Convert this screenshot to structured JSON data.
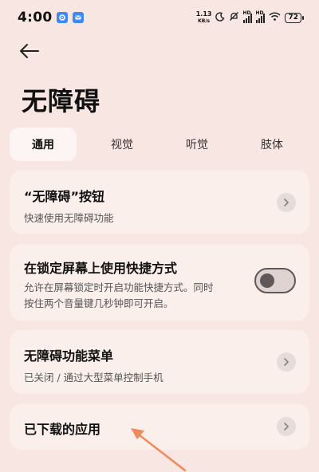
{
  "status_bar": {
    "time": "4:00",
    "net_speed_value": "1.13",
    "net_speed_unit": "KB/s",
    "sim1_tag": "HD",
    "sim2_tag": "HD",
    "battery": "72"
  },
  "header": {
    "title": "无障碍"
  },
  "tabs": [
    {
      "label": "通用",
      "active": true
    },
    {
      "label": "视觉",
      "active": false
    },
    {
      "label": "听觉",
      "active": false
    },
    {
      "label": "肢体",
      "active": false
    }
  ],
  "settings": {
    "button": {
      "title": "“无障碍”按钮",
      "subtitle": "快速使用无障碍功能"
    },
    "shortcut": {
      "title": "在锁定屏幕上使用快捷方式",
      "subtitle_line1": "允许在屏幕锁定时开启功能快捷方式。同时",
      "subtitle_line2": "按住两个音量键几秒钟即可开启。",
      "enabled": false
    },
    "menu": {
      "title": "无障碍功能菜单",
      "subtitle": "已关闭 / 通过大型菜单控制手机"
    },
    "downloaded": {
      "title": "已下载的应用"
    }
  },
  "colors": {
    "background": "#f7e6e2",
    "card": "#fbefec",
    "annotation_arrow": "#f08a5b"
  }
}
